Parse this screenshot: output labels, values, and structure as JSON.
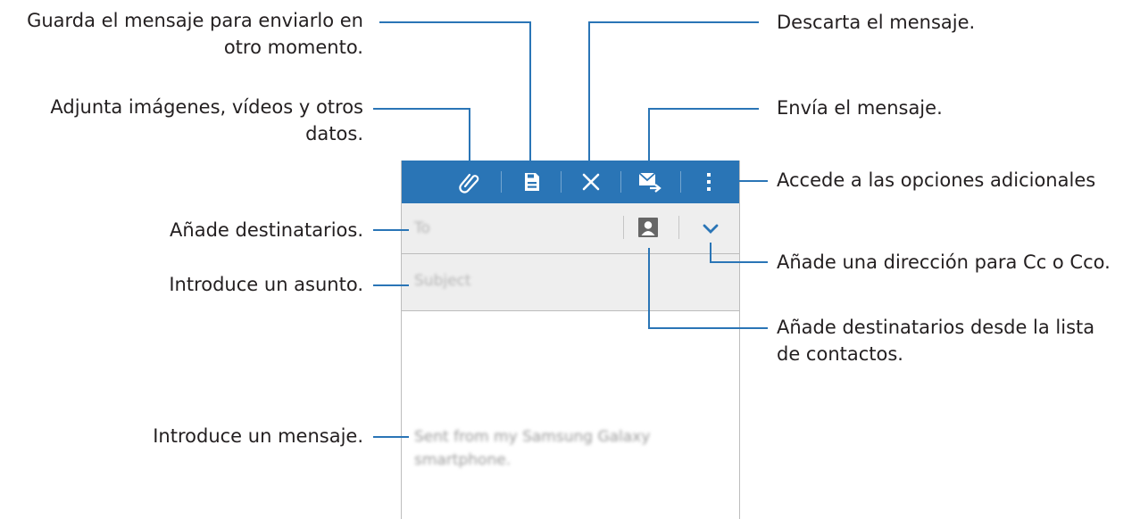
{
  "colors": {
    "accent": "#2a75b6",
    "line": "#2a75b6"
  },
  "compose": {
    "to_placeholder": "To",
    "subject_placeholder": "Subject",
    "body_text": "Sent from my Samsung Galaxy smartphone.",
    "toolbar_icons": [
      "paperclip-icon",
      "save-icon",
      "close-icon",
      "send-icon",
      "more-options-icon"
    ]
  },
  "callouts": {
    "save": [
      "Guarda el mensaje para enviarlo en",
      "otro momento."
    ],
    "attach": [
      "Adjunta imágenes, vídeos y otros",
      "datos."
    ],
    "add_recipients": "Añade destinatarios.",
    "subject": "Introduce un asunto.",
    "message": "Introduce un mensaje.",
    "discard": "Descarta el mensaje.",
    "send": "Envía el mensaje.",
    "more_options": "Accede a las opciones adicionales",
    "cc_bcc": "Añade una dirección para Cc o Cco.",
    "contacts": [
      "Añade destinatarios desde la lista",
      "de contactos."
    ]
  }
}
